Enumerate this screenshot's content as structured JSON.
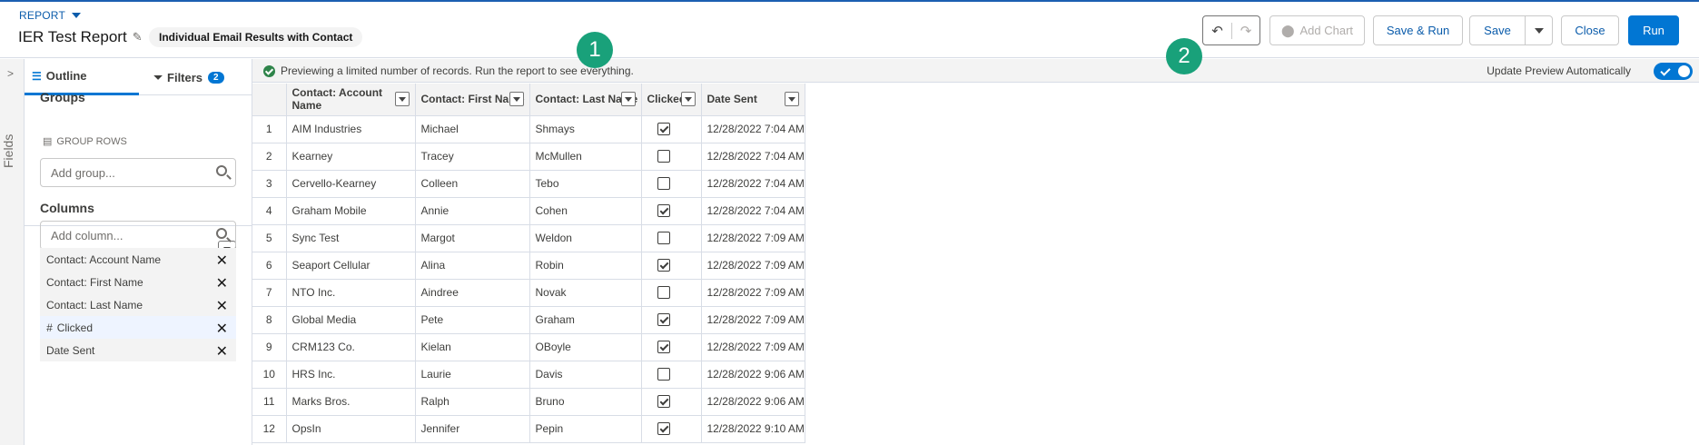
{
  "header": {
    "breadcrumb": "REPORT",
    "title": "IER Test Report",
    "report_type": "Individual Email Results with Contact",
    "buttons": {
      "add_chart": "Add Chart",
      "save_run": "Save & Run",
      "save": "Save",
      "close": "Close",
      "run": "Run"
    }
  },
  "sidebar_tab": {
    "label": "Fields"
  },
  "panel": {
    "tabs": {
      "outline": "Outline",
      "filters": "Filters",
      "filters_count": "2"
    },
    "groups": {
      "title": "Groups",
      "subtitle": "GROUP ROWS",
      "placeholder": "Add group..."
    },
    "columns": {
      "title": "Columns",
      "placeholder": "Add column...",
      "items": [
        {
          "label": "Contact: Account Name"
        },
        {
          "label": "Contact: First Name"
        },
        {
          "label": "Contact: Last Name"
        },
        {
          "label": "Clicked",
          "prefix": "#"
        },
        {
          "label": "Date Sent"
        }
      ]
    }
  },
  "preview": {
    "message": "Previewing a limited number of records. Run the report to see everything.",
    "auto_update_label": "Update Preview Automatically",
    "auto_update": true
  },
  "markers": [
    "1",
    "2"
  ],
  "table": {
    "headers": [
      "Contact: Account Name",
      "Contact: First Name",
      "Contact: Last Name",
      "Clicked",
      "Date Sent"
    ],
    "rows": [
      {
        "n": "1",
        "account": "AIM Industries",
        "first": "Michael",
        "last": "Shmays",
        "clicked": true,
        "date": "12/28/2022 7:04 AM"
      },
      {
        "n": "2",
        "account": "Kearney",
        "first": "Tracey",
        "last": "McMullen",
        "clicked": false,
        "date": "12/28/2022 7:04 AM"
      },
      {
        "n": "3",
        "account": "Cervello-Kearney",
        "first": "Colleen",
        "last": "Tebo",
        "clicked": false,
        "date": "12/28/2022 7:04 AM"
      },
      {
        "n": "4",
        "account": "Graham Mobile",
        "first": "Annie",
        "last": "Cohen",
        "clicked": true,
        "date": "12/28/2022 7:04 AM"
      },
      {
        "n": "5",
        "account": "Sync Test",
        "first": "Margot",
        "last": "Weldon",
        "clicked": false,
        "date": "12/28/2022 7:09 AM"
      },
      {
        "n": "6",
        "account": "Seaport Cellular",
        "first": "Alina",
        "last": "Robin",
        "clicked": true,
        "date": "12/28/2022 7:09 AM"
      },
      {
        "n": "7",
        "account": "NTO Inc.",
        "first": "Aindree",
        "last": "Novak",
        "clicked": false,
        "date": "12/28/2022 7:09 AM"
      },
      {
        "n": "8",
        "account": "Global Media",
        "first": "Pete",
        "last": "Graham",
        "clicked": true,
        "date": "12/28/2022 7:09 AM"
      },
      {
        "n": "9",
        "account": "CRM123 Co.",
        "first": "Kielan",
        "last": "OBoyle",
        "clicked": true,
        "date": "12/28/2022 7:09 AM"
      },
      {
        "n": "10",
        "account": "HRS Inc.",
        "first": "Laurie",
        "last": "Davis",
        "clicked": false,
        "date": "12/28/2022 9:06 AM"
      },
      {
        "n": "11",
        "account": "Marks Bros.",
        "first": "Ralph",
        "last": "Bruno",
        "clicked": true,
        "date": "12/28/2022 9:06 AM"
      },
      {
        "n": "12",
        "account": "OpsIn",
        "first": "Jennifer",
        "last": "Pepin",
        "clicked": true,
        "date": "12/28/2022 9:10 AM"
      }
    ]
  },
  "colors": {
    "brand": "#0176d3",
    "marker": "#19a17a",
    "success": "#2e844a"
  }
}
